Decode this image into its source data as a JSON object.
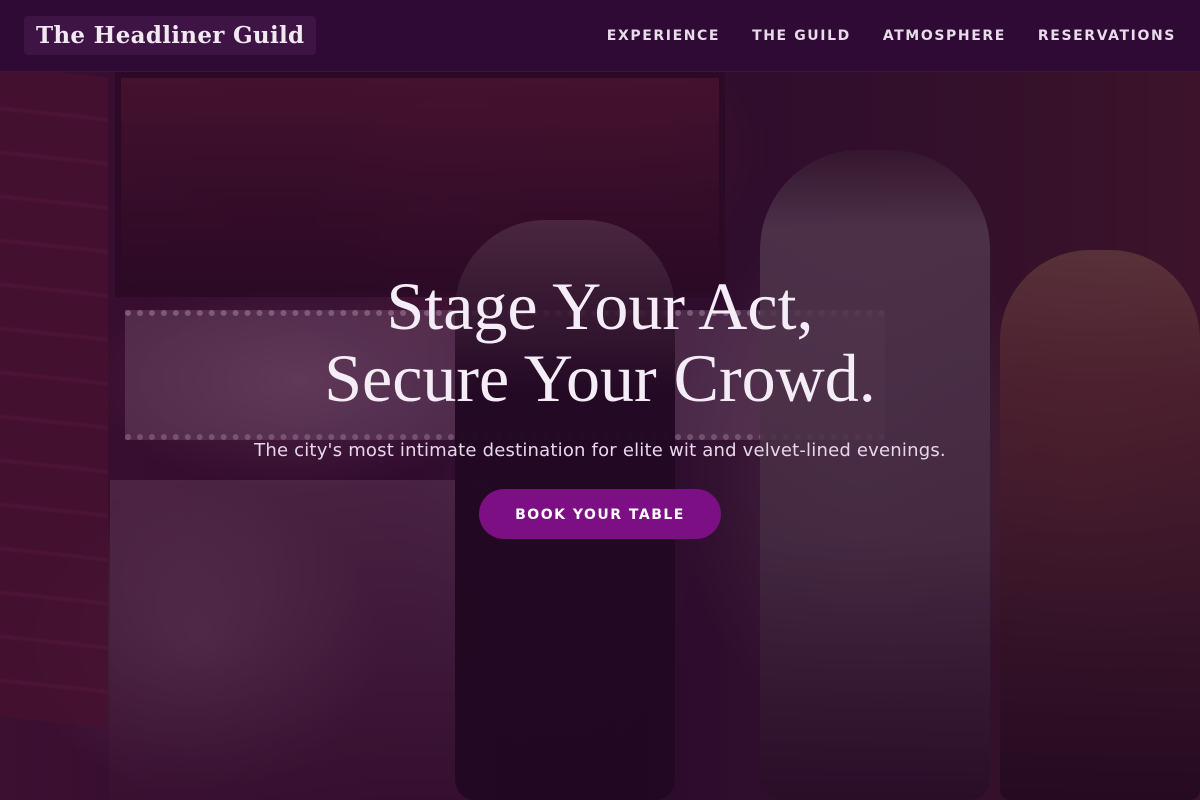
{
  "navbar": {
    "brand": "The Headliner Guild",
    "links": [
      {
        "label": "EXPERIENCE"
      },
      {
        "label": "THE GUILD"
      },
      {
        "label": "ATMOSPHERE"
      },
      {
        "label": "RESERVATIONS"
      }
    ]
  },
  "hero": {
    "headline_line1": "Stage Your Act,",
    "headline_line2": "Secure Your Crowd.",
    "tagline": "The city's most intimate destination for elite wit and velvet-lined evenings.",
    "cta_label": "BOOK YOUR TABLE"
  },
  "colors": {
    "navbar_bg": "#2e0a34",
    "accent": "#7c0f84",
    "text_light": "#f4ecf6"
  }
}
